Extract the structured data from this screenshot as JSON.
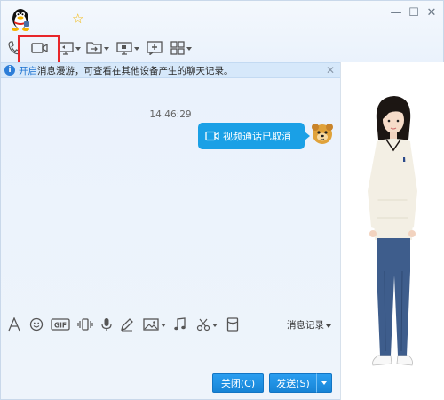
{
  "window": {
    "minimize_glyph": "—",
    "maximize_glyph": "☐",
    "close_glyph": "✕",
    "star_glyph": "☆"
  },
  "toolbar": {
    "items": [
      {
        "name": "voice-call",
        "icon": "phone-icon"
      },
      {
        "name": "video-call",
        "icon": "video-camera-icon",
        "highlighted": true
      },
      {
        "name": "remote-desktop",
        "icon": "remote-assist-icon",
        "dropdown": true
      },
      {
        "name": "send-file",
        "icon": "file-transfer-icon",
        "dropdown": true
      },
      {
        "name": "screen-share",
        "icon": "screen-share-icon",
        "dropdown": true
      },
      {
        "name": "launch-group",
        "icon": "add-chat-icon"
      },
      {
        "name": "apps",
        "icon": "apps-grid-icon",
        "dropdown": true
      }
    ],
    "highlight_color": "#e8262a"
  },
  "infobar": {
    "icon": "i",
    "link_text": "开启",
    "text": "消息漫游，可查看在其他设备产生的聊天记录。",
    "close_glyph": "✕"
  },
  "chat": {
    "timestamp": "14:46:29",
    "bubble_text": "视频通话已取消",
    "bubble_color": "#1aa0e6"
  },
  "input_toolbar": {
    "history_label": "消息记录"
  },
  "buttons": {
    "close_label": "关闭(C)",
    "send_label": "发送(S)"
  },
  "colors": {
    "accent": "#1784d6",
    "info_bg": "#d6e8fa"
  }
}
